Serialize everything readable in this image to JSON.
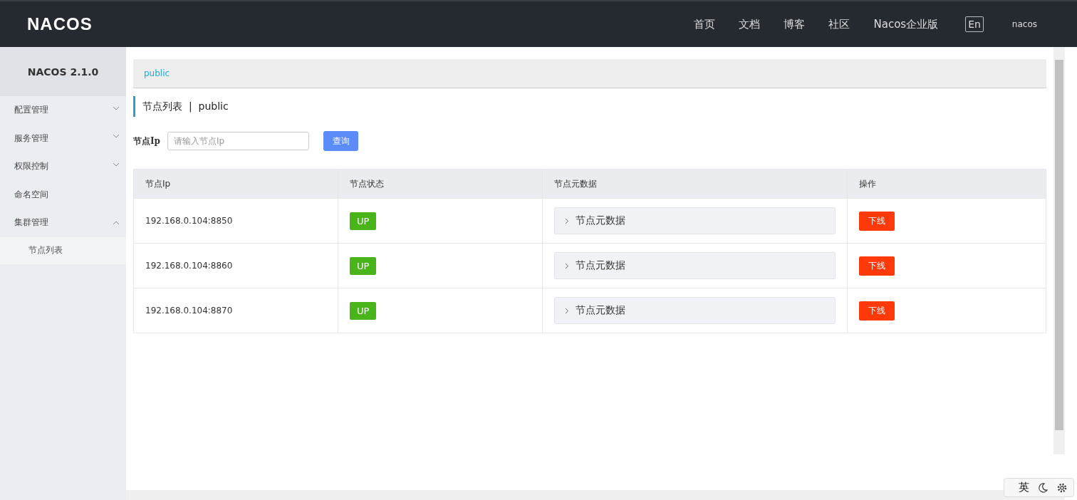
{
  "header": {
    "logo": "NACOS",
    "nav": [
      "首页",
      "文档",
      "博客",
      "社区",
      "Nacos企业版"
    ],
    "language": "En",
    "user": "nacos"
  },
  "sidebar": {
    "title": "NACOS 2.1.0",
    "items": [
      {
        "label": "配置管理",
        "kind": "group",
        "expanded": false
      },
      {
        "label": "服务管理",
        "kind": "group",
        "expanded": false
      },
      {
        "label": "权限控制",
        "kind": "group",
        "expanded": false
      },
      {
        "label": "命名空间",
        "kind": "link"
      },
      {
        "label": "集群管理",
        "kind": "group",
        "expanded": true,
        "children": [
          {
            "label": "节点列表",
            "selected": true
          }
        ]
      }
    ]
  },
  "breadcrumb": "public",
  "page_title": {
    "title": "节点列表",
    "separator": "|",
    "namespace": "public"
  },
  "filter": {
    "label": "节点Ip",
    "placeholder": "请输入节点Ip",
    "button": "查询"
  },
  "table": {
    "columns": [
      "节点Ip",
      "节点状态",
      "节点元数据",
      "操作"
    ],
    "rows": [
      {
        "ip": "192.168.0.104:8850",
        "status": "UP",
        "metadata": {
          "label": "节点元数据",
          "expanded": false
        },
        "action": "下线"
      },
      {
        "ip": "192.168.0.104:8860",
        "status": "UP",
        "metadata": {
          "label": "节点元数据",
          "expanded": false
        },
        "action": "下线"
      },
      {
        "ip": "192.168.0.104:8870",
        "status": "UP",
        "metadata": {
          "label": "节点元数据",
          "expanded": false
        },
        "action": "下线"
      }
    ]
  },
  "ime": {
    "mode": "英"
  }
}
